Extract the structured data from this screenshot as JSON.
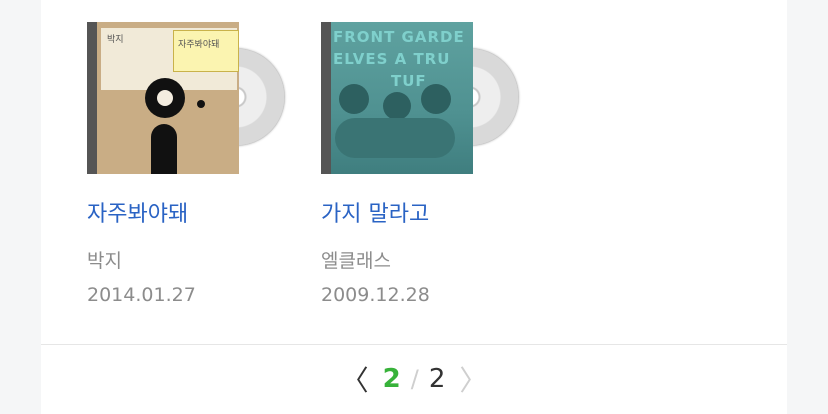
{
  "albums": [
    {
      "title": "자주봐야돼",
      "artist": "박지",
      "date": "2014.01.27",
      "cover_label": "박지",
      "cover_note": "자주봐야돼"
    },
    {
      "title": "가지 말라고",
      "artist": "엘클래스",
      "date": "2009.12.28",
      "cover_lines": [
        "FRONT GARDE",
        "ELVES   A TRU",
        "TUF"
      ]
    }
  ],
  "pagination": {
    "prev_symbol": "〈",
    "current": "2",
    "separator": "/",
    "total": "2",
    "next_symbol": "〉"
  },
  "colors": {
    "title_link": "#2a63c4",
    "meta_text": "#8c8c8c",
    "current_page": "#38b23a"
  }
}
